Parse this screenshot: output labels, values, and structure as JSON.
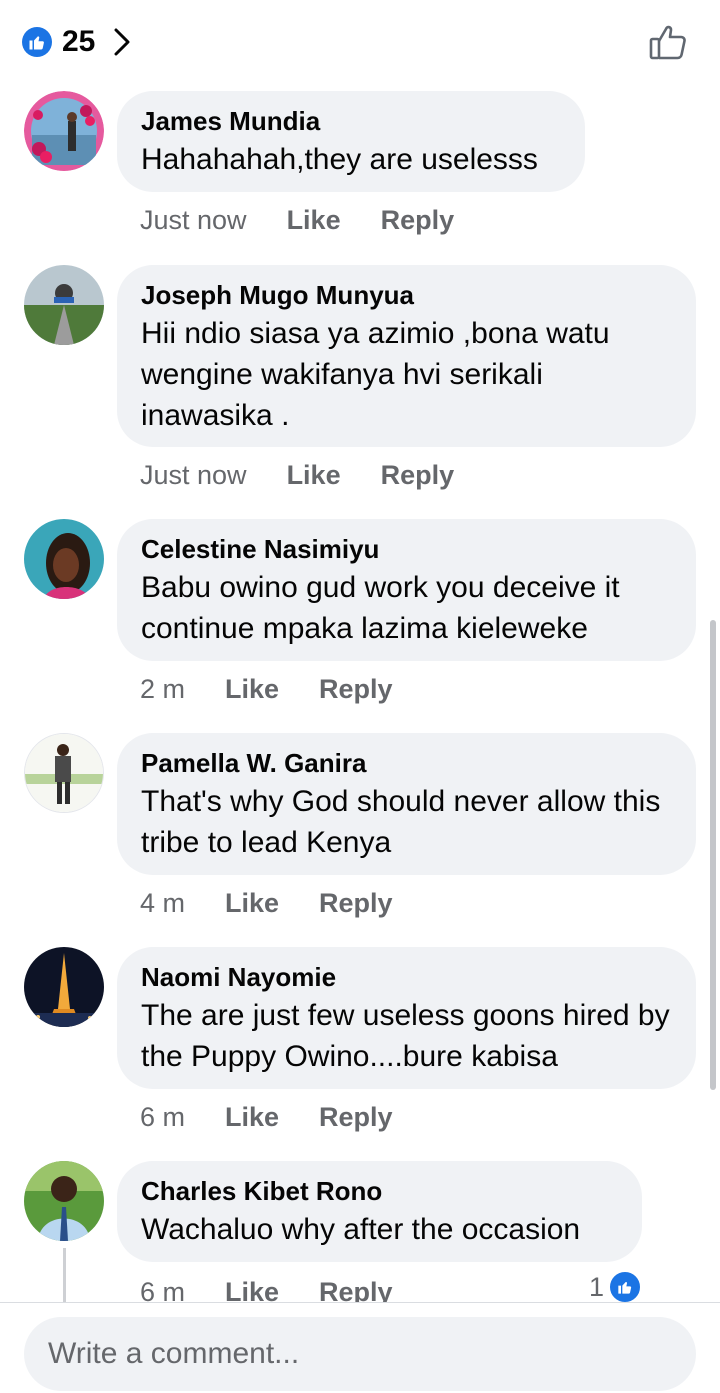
{
  "header": {
    "like_count": "25"
  },
  "comments": [
    {
      "author": "James Mundia",
      "text": "Hahahahah,they are uselesss",
      "time": "Just now",
      "like": "Like",
      "reply": "Reply"
    },
    {
      "author": "Joseph Mugo Munyua",
      "text": "Hii ndio siasa ya azimio ,bona watu wengine wakifanya hvi serikali inawasika .",
      "time": "Just now",
      "like": "Like",
      "reply": "Reply"
    },
    {
      "author": "Celestine Nasimiyu",
      "text": "Babu owino gud work you deceive it continue mpaka lazima kieleweke",
      "time": "2 m",
      "like": "Like",
      "reply": "Reply"
    },
    {
      "author": "Pamella W. Ganira",
      "text": "That's why God should never allow this tribe to lead Kenya",
      "time": "4 m",
      "like": "Like",
      "reply": "Reply"
    },
    {
      "author": "Naomi Nayomie",
      "text": "The are just few useless goons hired by the Puppy Owino....bure kabisa",
      "time": "6 m",
      "like": "Like",
      "reply": "Reply"
    },
    {
      "author": "Charles Kibet Rono",
      "text": "Wachaluo why after the occasion",
      "time": "6 m",
      "like": "Like",
      "reply": "Reply",
      "reaction_count": "1"
    }
  ],
  "composer": {
    "placeholder": "Write a comment..."
  },
  "colors": {
    "accent": "#1b74e4",
    "bubble": "#f0f2f5",
    "meta_text": "#65676b"
  },
  "icons": [
    "like-badge-icon",
    "chevron-right-icon",
    "thumbs-up-outline-icon"
  ]
}
